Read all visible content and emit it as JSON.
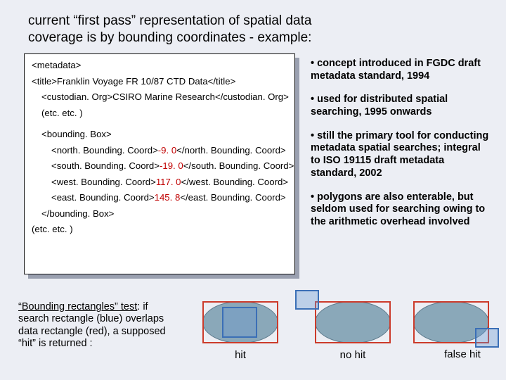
{
  "title": "current “first pass” representation of spatial data coverage is by bounding coordinates - example:",
  "code": {
    "l0": "<metadata>",
    "l1": "<title>Franklin Voyage FR 10/87 CTD Data</title>",
    "l2": "<custodian. Org>CSIRO Marine Research</custodian. Org>",
    "l3": "(etc. etc. )",
    "l4": "<bounding. Box>",
    "north_open": "<north. Bounding. Coord>",
    "north_val": "-9. 0",
    "north_close": "</north. Bounding. Coord>",
    "south_open": "<south. Bounding. Coord>",
    "south_val": "-19. 0",
    "south_close": "</south. Bounding. Coord>",
    "west_open": "<west. Bounding. Coord>",
    "west_val": "117. 0",
    "west_close": "</west. Bounding. Coord>",
    "east_open": "<east. Bounding. Coord>",
    "east_val": "145. 8",
    "east_close": "</east. Bounding. Coord>",
    "l9": "</bounding. Box>",
    "l10": "(etc. etc. )"
  },
  "bullets": {
    "p1": "• concept introduced in FGDC draft metadata standard, 1994",
    "p2": "• used for distributed spatial searching, 1995 onwards",
    "p3": "• still the primary tool for conducting metadata spatial searches; integral to ISO 19115 draft metadata standard, 2002",
    "p4": "• polygons are also enterable, but seldom used for searching owing to the arithmetic overhead involved"
  },
  "footer": {
    "pre": "“Bounding rectangles” test",
    "rest": ": if search rectangle (blue) overlaps data rectangle (red), a supposed “hit” is returned :"
  },
  "captions": {
    "hit": "hit",
    "nohit": "no hit",
    "falsehit": "false hit"
  }
}
